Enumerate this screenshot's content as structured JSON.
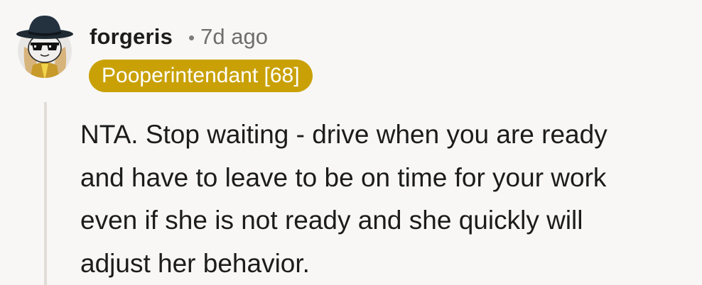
{
  "comment": {
    "username": "forgeris",
    "separator": "•",
    "time_ago": "7d ago",
    "flair": "Pooperintendant [68]",
    "body_lines": [
      "NTA. Stop waiting - drive when you are ready",
      "and have to leave to be on time for your work",
      "even if she is not ready and she quickly will",
      "adjust her behavior."
    ]
  },
  "colors": {
    "background": "#f8f7f6",
    "flair_background": "#c9a106",
    "flair_text": "#ffffff",
    "thread_line": "#e2dcd7",
    "text": "#1c1c1c",
    "muted_text": "#6e6e6e"
  },
  "icons": {
    "avatar": "snoo-avatar-with-black-hat-and-sunglasses"
  }
}
